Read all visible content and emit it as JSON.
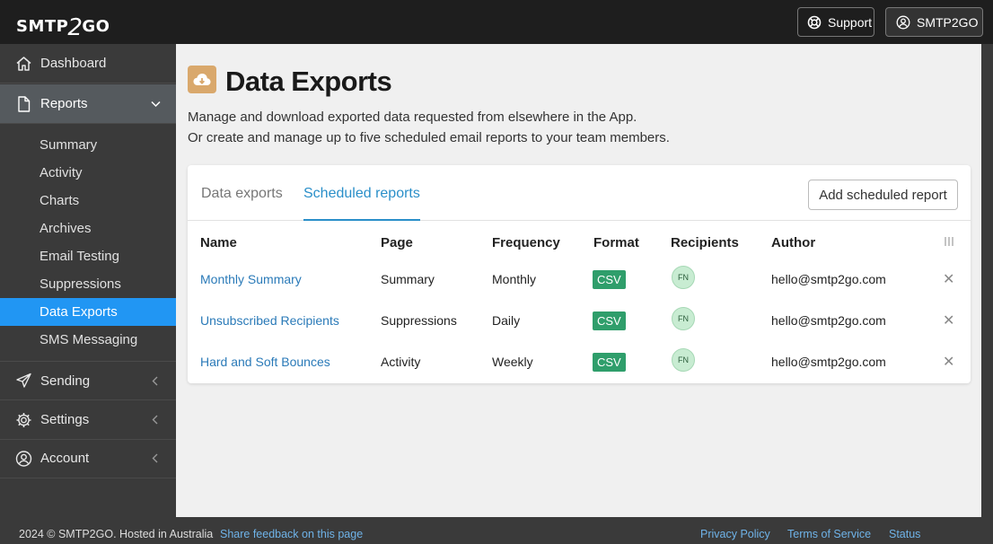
{
  "brand": {
    "logo_text_left": "SMTP",
    "logo_text_two": "2",
    "logo_text_right": "GO"
  },
  "topbar": {
    "support_label": "Support",
    "account_label": "SMTP2GO"
  },
  "sidebar": {
    "dashboard": "Dashboard",
    "reports": "Reports",
    "report_items": [
      "Summary",
      "Activity",
      "Charts",
      "Archives",
      "Email Testing",
      "Suppressions",
      "Data Exports",
      "SMS Messaging"
    ],
    "sending": "Sending",
    "settings": "Settings",
    "account": "Account"
  },
  "page": {
    "title": "Data Exports",
    "desc_line1": "Manage and download exported data requested from elsewhere in the App.",
    "desc_line2": "Or create and manage up to five scheduled email reports to your team members."
  },
  "tabs": {
    "data_exports": "Data exports",
    "scheduled_reports": "Scheduled reports",
    "active": "Scheduled reports"
  },
  "add_button": "Add scheduled report",
  "table": {
    "headers": {
      "name": "Name",
      "page": "Page",
      "frequency": "Frequency",
      "format": "Format",
      "recipients": "Recipients",
      "author": "Author"
    },
    "rows": [
      {
        "name": "Monthly Summary",
        "page": "Summary",
        "frequency": "Monthly",
        "format": "CSV",
        "recipient": "FN",
        "author": "hello@smtp2go.com"
      },
      {
        "name": "Unsubscribed Recipients",
        "page": "Suppressions",
        "frequency": "Daily",
        "format": "CSV",
        "recipient": "FN",
        "author": "hello@smtp2go.com"
      },
      {
        "name": "Hard and Soft Bounces",
        "page": "Activity",
        "frequency": "Weekly",
        "format": "CSV",
        "recipient": "FN",
        "author": "hello@smtp2go.com"
      }
    ]
  },
  "footer": {
    "copyright": "2024 © SMTP2GO. Hosted in Australia",
    "feedback": "Share feedback on this page",
    "privacy": "Privacy Policy",
    "terms": "Terms of Service",
    "status": "Status"
  },
  "colors": {
    "accent": "#2196f3",
    "link": "#2a7ab8",
    "badge": "#2f9e6b",
    "icon_bg": "#d9a86c"
  }
}
